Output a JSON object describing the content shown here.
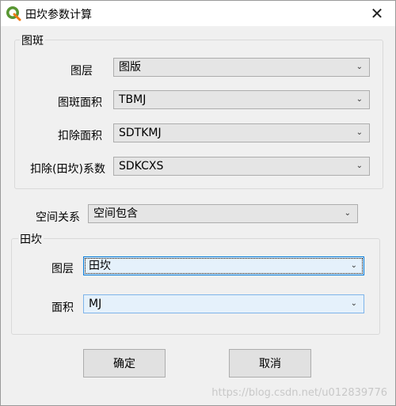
{
  "window": {
    "title": "田坎参数计算",
    "close_glyph": "✕"
  },
  "group_tuban": {
    "title": "图斑",
    "rows": [
      {
        "label": "图层",
        "value": "图版"
      },
      {
        "label": "图斑面积",
        "value": "TBMJ"
      },
      {
        "label": "扣除面积",
        "value": "SDTKMJ"
      },
      {
        "label": "扣除(田坎)系数",
        "value": "SDKCXS"
      }
    ]
  },
  "spatial": {
    "label": "空间关系",
    "value": "空间包含"
  },
  "group_tiankan": {
    "title": "田坎",
    "rows": [
      {
        "label": "图层",
        "value": "田坎"
      },
      {
        "label": "面积",
        "value": "MJ"
      }
    ]
  },
  "buttons": {
    "ok": "确定",
    "cancel": "取消"
  },
  "watermark": "https://blog.csdn.net/u012839776",
  "icons": {
    "app": "qgis-logo-icon",
    "dropdown": "chevron-down-icon",
    "close": "close-icon"
  },
  "colors": {
    "focus_border": "#0078d7",
    "selected_bg": "#e5f1fb"
  }
}
